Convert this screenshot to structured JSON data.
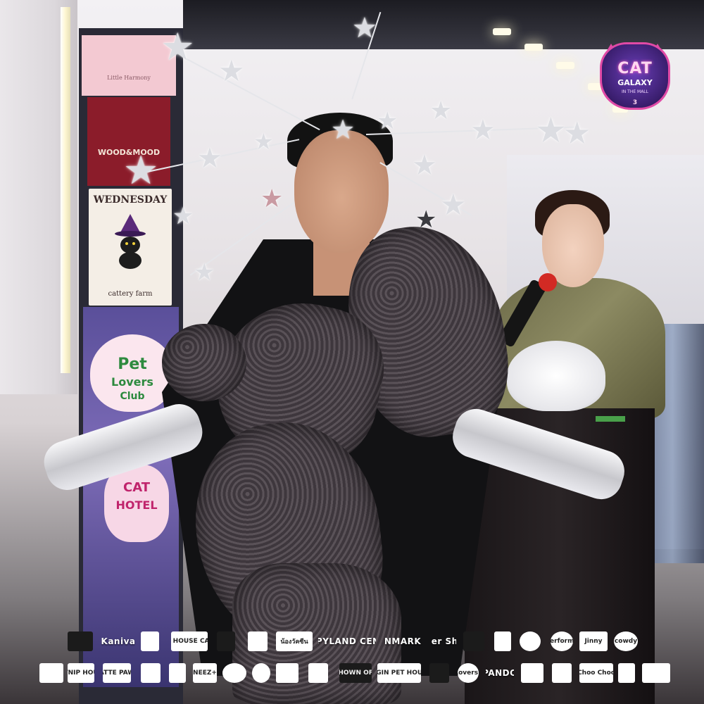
{
  "badge": {
    "title": "CAT",
    "subtitle": "GALAXY",
    "tagline": "IN THE MALL",
    "number": "3"
  },
  "signage": {
    "top_sign": "Little Harmony",
    "wood_sign": "WOOD&MOOD",
    "wednesday_title": "WEDNESDAY",
    "wednesday_sub": "cattery farm",
    "pet_lovers_line1": "Pet",
    "pet_lovers_line2": "Lovers",
    "pet_lovers_line3": "Club",
    "cat_hotel_line1": "CAT",
    "cat_hotel_line2": "HOTEL"
  },
  "sponsors_row1": [
    {
      "label": "",
      "style": "dark"
    },
    {
      "label": "Kaniva",
      "style": "txt"
    },
    {
      "label": "",
      "style": "plain"
    },
    {
      "label": "CATNIP HOUSE CAT CAFE",
      "style": "plain"
    },
    {
      "label": "",
      "style": "dark"
    },
    {
      "label": "",
      "style": "plain"
    },
    {
      "label": "น้องวัคซีน",
      "style": "plain"
    },
    {
      "label": "HAPPYLAND CENTER",
      "style": "txt"
    },
    {
      "label": "NMARK",
      "style": "txt"
    },
    {
      "label": "Cheer Share",
      "style": "txt"
    },
    {
      "label": "",
      "style": "dark"
    },
    {
      "label": "",
      "style": "plain"
    },
    {
      "label": "",
      "style": "round"
    },
    {
      "label": "Performa",
      "style": "round"
    },
    {
      "label": "Jinny",
      "style": "plain"
    },
    {
      "label": "cowdy",
      "style": "round"
    }
  ],
  "sponsors_row2": [
    {
      "label": "",
      "style": "plain"
    },
    {
      "label": "CATNIP HOUSE",
      "style": "plain"
    },
    {
      "label": "CATTE PAWS",
      "style": "plain"
    },
    {
      "label": "",
      "style": "plain"
    },
    {
      "label": "",
      "style": "plain"
    },
    {
      "label": "NEEZ+",
      "style": "plain"
    },
    {
      "label": "",
      "style": "round"
    },
    {
      "label": "",
      "style": "round"
    },
    {
      "label": "",
      "style": "plain"
    },
    {
      "label": "",
      "style": "plain"
    },
    {
      "label": "SHOWN OFF",
      "style": "dark"
    },
    {
      "label": "BEGIN PET HOUSE",
      "style": "plain"
    },
    {
      "label": "",
      "style": "dark"
    },
    {
      "label": "Pet Lovers Club",
      "style": "round"
    },
    {
      "label": "PANDO",
      "style": "txt"
    },
    {
      "label": "",
      "style": "plain"
    },
    {
      "label": "",
      "style": "plain"
    },
    {
      "label": "Choo Choo",
      "style": "plain"
    },
    {
      "label": "",
      "style": "plain"
    },
    {
      "label": "",
      "style": "plain"
    }
  ],
  "colors": {
    "badge_accent": "#e04aa6",
    "coat": "#121214",
    "glove": "#e5e5ea",
    "presenter_jacket": "#7a7852",
    "podium": "#1f1a1c"
  }
}
